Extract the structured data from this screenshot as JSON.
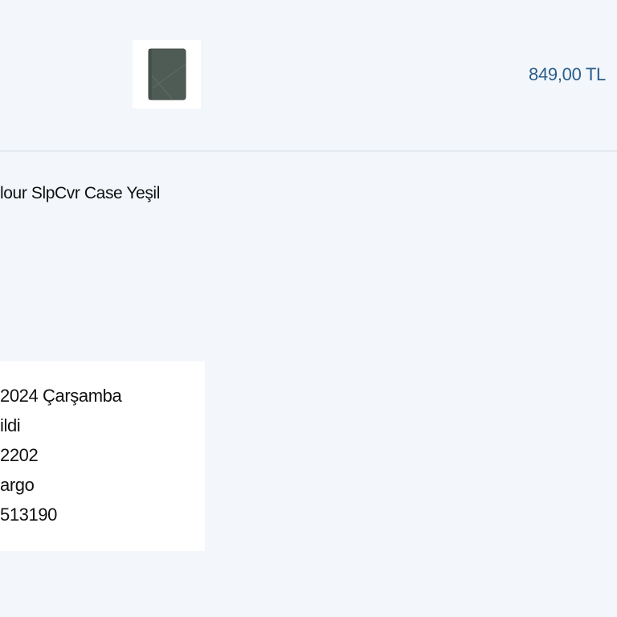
{
  "order_item": {
    "product_name": "lour SlpCvr Case Yeşil",
    "price": "849,00 TL",
    "thumbnail_color": "#4f5c55"
  },
  "order_info": {
    "lines": [
      "2024 Çarşamba",
      "ildi",
      "2202",
      "argo",
      "513190"
    ]
  },
  "colors": {
    "background": "#f3f7fb",
    "price": "#2a5d8c",
    "text": "#111111",
    "card": "#ffffff"
  }
}
